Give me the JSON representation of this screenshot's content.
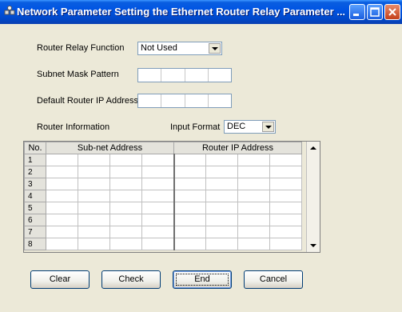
{
  "window": {
    "title": "Network Parameter  Setting the Ethernet Router Relay Parameter ...",
    "controls": {
      "minimize_icon": "minimize-icon",
      "maximize_icon": "maximize-icon",
      "close_icon": "close-icon"
    }
  },
  "form": {
    "router_relay_function": {
      "label": "Router Relay Function",
      "value": "Not Used"
    },
    "subnet_mask_pattern": {
      "label": "Subnet Mask Pattern",
      "octets": [
        "",
        "",
        "",
        ""
      ]
    },
    "default_router_ip": {
      "label": "Default Router IP Address",
      "octets": [
        "",
        "",
        "",
        ""
      ]
    },
    "router_information": {
      "label": "Router Information"
    },
    "input_format": {
      "label": "Input Format",
      "value": "DEC"
    }
  },
  "table": {
    "columns": [
      "No.",
      "Sub-net Address",
      "Router IP Address"
    ],
    "rows": [
      "1",
      "2",
      "3",
      "4",
      "5",
      "6",
      "7",
      "8"
    ]
  },
  "buttons": {
    "clear": "Clear",
    "check": "Check",
    "end": "End",
    "cancel": "Cancel"
  }
}
